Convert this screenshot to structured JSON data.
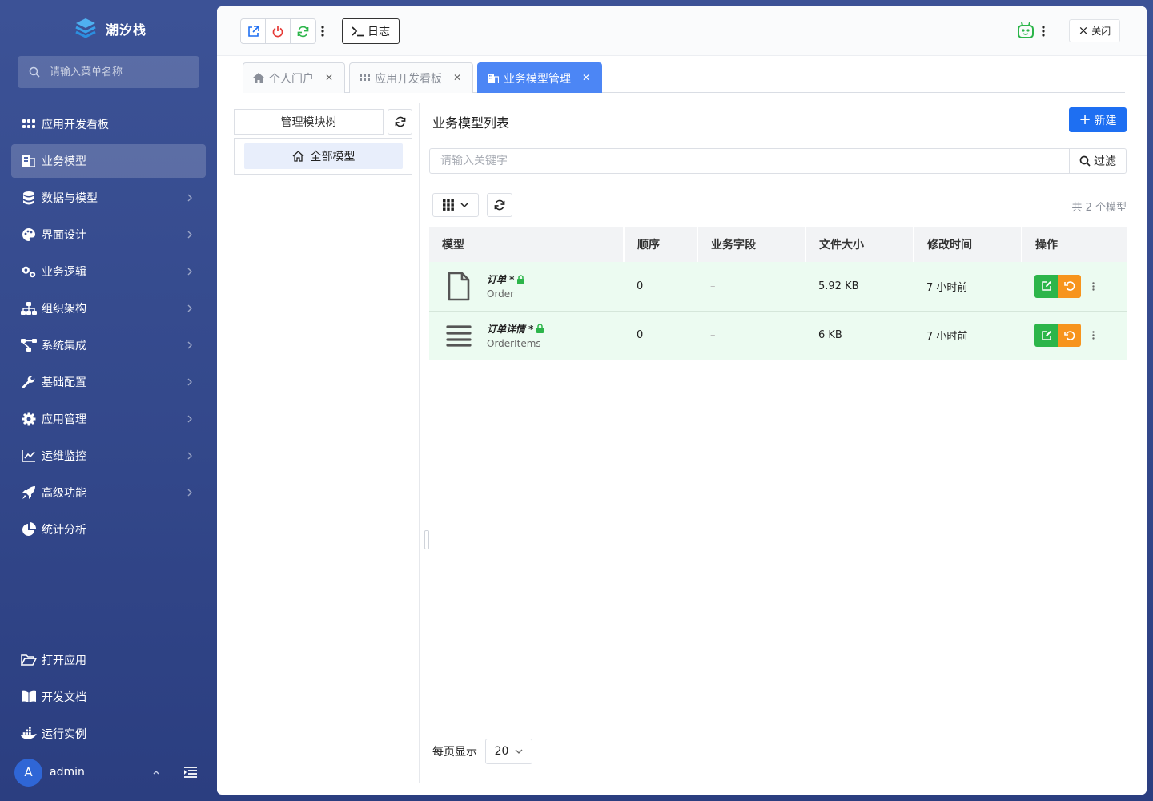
{
  "app": {
    "name": "潮汐栈"
  },
  "menu_search": {
    "placeholder": "请输入菜单名称"
  },
  "nav": {
    "items": [
      {
        "label": "应用开发看板",
        "icon": "grid-icon",
        "has_children": false,
        "active": false
      },
      {
        "label": "业务模型",
        "icon": "building-icon",
        "has_children": false,
        "active": true
      },
      {
        "label": "数据与模型",
        "icon": "database-icon",
        "has_children": true,
        "active": false
      },
      {
        "label": "界面设计",
        "icon": "palette-icon",
        "has_children": true,
        "active": false
      },
      {
        "label": "业务逻辑",
        "icon": "cogs-icon",
        "has_children": true,
        "active": false
      },
      {
        "label": "组织架构",
        "icon": "sitemap-icon",
        "has_children": true,
        "active": false
      },
      {
        "label": "系统集成",
        "icon": "project-diagram-icon",
        "has_children": true,
        "active": false
      },
      {
        "label": "基础配置",
        "icon": "wrench-icon",
        "has_children": true,
        "active": false
      },
      {
        "label": "应用管理",
        "icon": "gear-icon",
        "has_children": true,
        "active": false
      },
      {
        "label": "运维监控",
        "icon": "line-chart-icon",
        "has_children": true,
        "active": false
      },
      {
        "label": "高级功能",
        "icon": "rocket-icon",
        "has_children": true,
        "active": false
      },
      {
        "label": "统计分析",
        "icon": "pie-chart-icon",
        "has_children": false,
        "active": false
      }
    ],
    "bottom": [
      {
        "label": "打开应用",
        "icon": "folder-open-icon"
      },
      {
        "label": "开发文档",
        "icon": "book-icon"
      },
      {
        "label": "运行实例",
        "icon": "docker-icon"
      }
    ]
  },
  "user": {
    "avatar_letter": "A",
    "name": "admin"
  },
  "toolbar": {
    "log_label": "日志",
    "close_label": "关闭"
  },
  "tabs": [
    {
      "label": "个人门户",
      "icon": "home-icon",
      "active": false
    },
    {
      "label": "应用开发看板",
      "icon": "grid-icon",
      "active": false
    },
    {
      "label": "业务模型管理",
      "icon": "building-icon",
      "active": true
    }
  ],
  "tree": {
    "title": "管理模块树",
    "root_label": "全部模型"
  },
  "list": {
    "title": "业务模型列表",
    "new_label": "新建",
    "filter_placeholder": "请输入关键字",
    "filter_label": "过滤",
    "count_text": "共 2 个模型",
    "columns": [
      "模型",
      "顺序",
      "业务字段",
      "文件大小",
      "修改时间",
      "操作"
    ],
    "rows": [
      {
        "icon": "file-icon",
        "name": "订单 *",
        "sub": "Order",
        "order": "0",
        "fields": "–",
        "size": "5.92 KB",
        "modified": "7 小时前"
      },
      {
        "icon": "list-icon",
        "name": "订单详情 *",
        "sub": "OrderItems",
        "order": "0",
        "fields": "–",
        "size": "6 KB",
        "modified": "7 小时前"
      }
    ]
  },
  "pager": {
    "label": "每页显示",
    "page_size": "20"
  },
  "colors": {
    "accent": "#1e6ff2",
    "active_tab": "#4c86f5",
    "edit": "#2cb54a",
    "reset": "#f7941d",
    "row_bg": "#ecfbf1"
  }
}
